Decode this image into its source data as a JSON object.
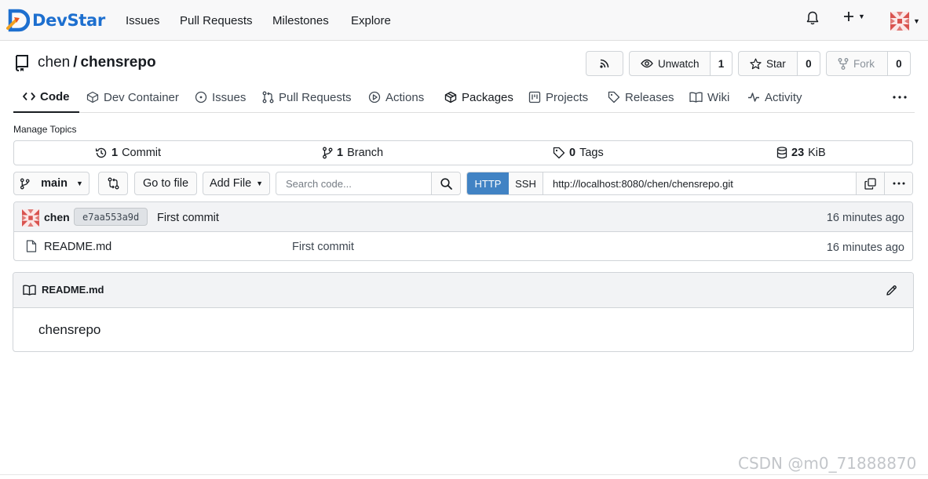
{
  "app": {
    "brand": "DevStar",
    "brand_color": "#1d6fcf",
    "accent_color": "#4183c4"
  },
  "topnav": {
    "links": [
      "Issues",
      "Pull Requests",
      "Milestones",
      "Explore"
    ]
  },
  "repo": {
    "owner": "chen",
    "separator": "/",
    "name": "chensrepo",
    "rss_icon": "rss-icon",
    "watch": {
      "label": "Unwatch",
      "count": "1"
    },
    "star": {
      "label": "Star",
      "count": "0"
    },
    "fork": {
      "label": "Fork",
      "count": "0"
    }
  },
  "tabs": [
    {
      "label": "Code",
      "icon": "code-icon",
      "active": true
    },
    {
      "label": "Dev Container",
      "icon": "container-icon"
    },
    {
      "label": "Issues",
      "icon": "issue-icon"
    },
    {
      "label": "Pull Requests",
      "icon": "pull-request-icon"
    },
    {
      "label": "Actions",
      "icon": "play-icon"
    },
    {
      "label": "Packages",
      "icon": "package-icon"
    },
    {
      "label": "Projects",
      "icon": "project-icon"
    },
    {
      "label": "Releases",
      "icon": "tag-icon"
    },
    {
      "label": "Wiki",
      "icon": "book-icon"
    },
    {
      "label": "Activity",
      "icon": "pulse-icon"
    }
  ],
  "manage_topics": "Manage Topics",
  "stats": {
    "commits": {
      "count": "1",
      "label": "Commit"
    },
    "branches": {
      "count": "1",
      "label": "Branch"
    },
    "tags": {
      "count": "0",
      "label": "Tags"
    },
    "size": {
      "value": "23",
      "unit": "KiB"
    }
  },
  "toolbar": {
    "branch": "main",
    "go_to_file": "Go to file",
    "add_file": "Add File",
    "search_placeholder": "Search code...",
    "clone_http": "HTTP",
    "clone_ssh": "SSH",
    "clone_url": "http://localhost:8080/chen/chensrepo.git"
  },
  "latest_commit": {
    "author": "chen",
    "sha": "e7aa553a9d",
    "message": "First commit",
    "time": "16 minutes ago"
  },
  "files": [
    {
      "name": "README.md",
      "commit": "First commit",
      "time": "16 minutes ago",
      "icon": "file-icon"
    }
  ],
  "readme": {
    "title": "README.md",
    "content": "chensrepo"
  },
  "watermark": "CSDN @m0_71888870"
}
